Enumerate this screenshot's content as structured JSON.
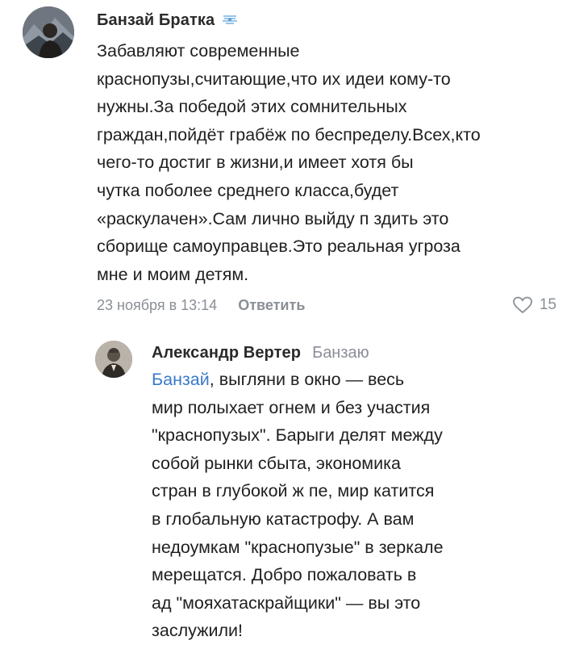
{
  "comments": [
    {
      "author": "Банзай Братка",
      "text_lines": [
        "Забавляют современные",
        "краснопузы,считающие,что их идеи кому-то",
        "нужны.За победой этих сомнительных",
        "граждан,пойдёт грабёж по беспределу.Всех,кто",
        "чего-то достиг в жизни,и имеет хотя бы",
        "чутка поболее среднего класса,будет",
        "«раскулачен».Сам лично выйду п  здить это",
        "сборище самоуправцев.Это реальная угроза",
        "мне и моим детям."
      ],
      "timestamp": "23 ноября в 13:14",
      "reply_label": "Ответить",
      "likes": "15"
    },
    {
      "author": "Александр Вертер",
      "reply_to": "Банзаю",
      "mention": "Банзай",
      "first_line_rest": ", выгляни в окно — весь",
      "text_lines": [
        "мир полыхает огнем и без участия",
        "\"краснопузых\". Барыги делят между",
        "собой рынки сбыта, экономика",
        "стран в глубокой ж  пе, мир катится",
        "в глобальную катастрофу. А вам",
        "недоумкам \"краснопузые\" в зеркале",
        "мерещатся. Добро пожаловать в",
        "ад \"мояхатаскрайщики\" — вы это",
        "заслужили!"
      ]
    }
  ],
  "colors": {
    "text": "#1f1f1f",
    "secondary": "#8a8f96",
    "mention": "#3a79c8"
  },
  "icons": [
    "user-avatar",
    "club-badge-icon",
    "heart-icon",
    "user-avatar"
  ]
}
